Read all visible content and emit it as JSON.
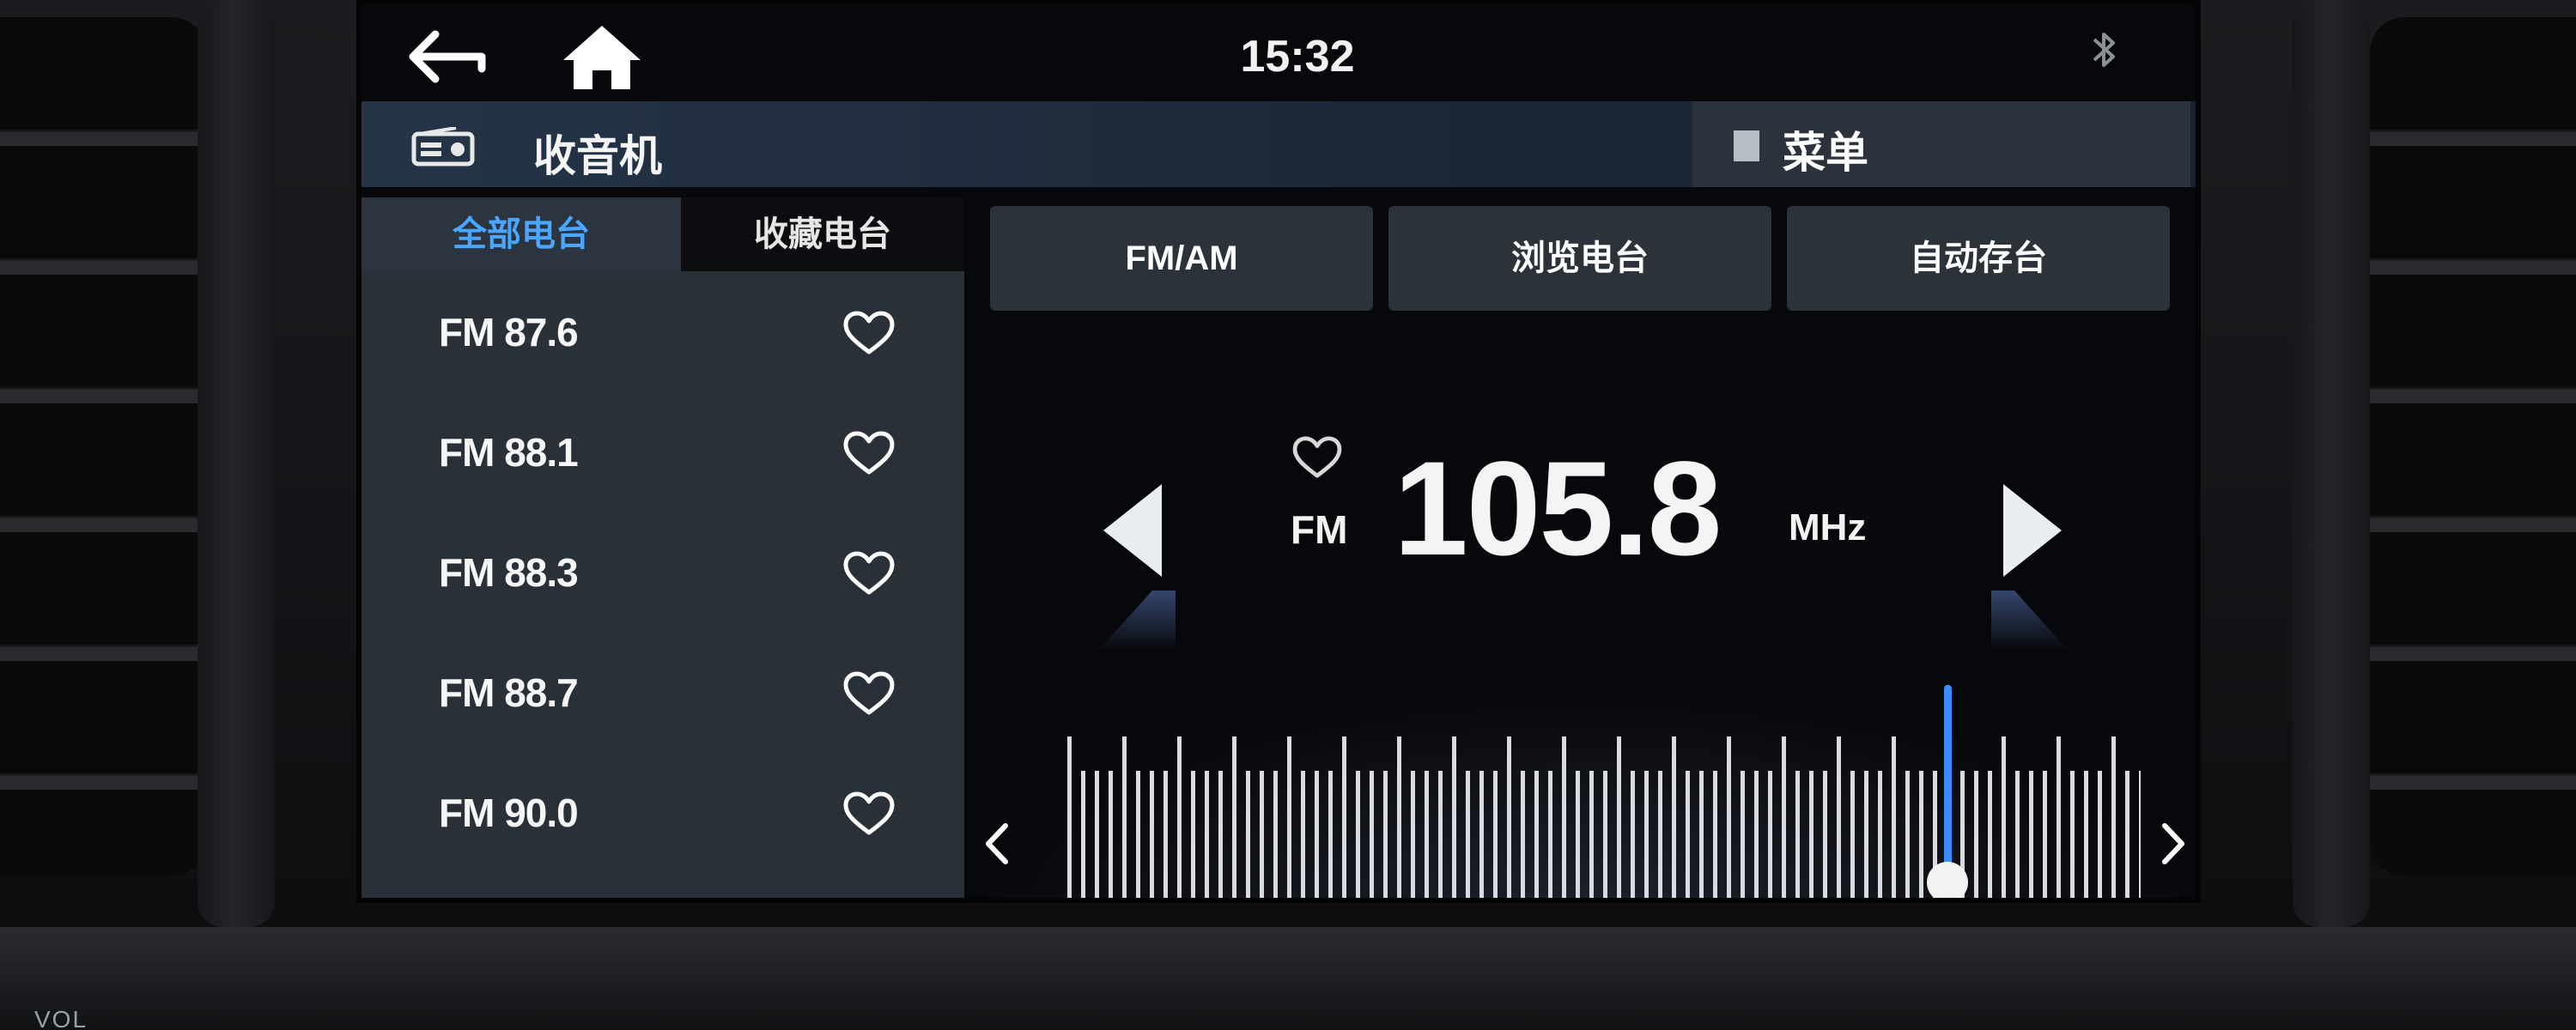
{
  "status": {
    "time": "15:32"
  },
  "title": {
    "text": "收音机"
  },
  "menu": {
    "label": "菜单"
  },
  "tabs": [
    {
      "label": "全部电台",
      "active": true
    },
    {
      "label": "收藏电台",
      "active": false
    }
  ],
  "stations": [
    {
      "name": "FM 87.6"
    },
    {
      "name": "FM 88.1"
    },
    {
      "name": "FM 88.3"
    },
    {
      "name": "FM 88.7"
    },
    {
      "name": "FM 90.0"
    }
  ],
  "buttons": {
    "fm_am": "FM/AM",
    "browse": "浏览电台",
    "autostore": "自动存台"
  },
  "tuner": {
    "band": "FM",
    "frequency": "105.8",
    "unit": "MHz"
  },
  "icons": {
    "back": "back-arrow-icon",
    "home": "home-icon",
    "bluetooth": "bluetooth-icon",
    "radio": "radio-icon",
    "favorite": "heart-outline-icon"
  },
  "colors": {
    "active_tab_text": "#4aa6ff",
    "tuner_needle": "#3a8dff",
    "panel_bg": "#2a3038",
    "button_bg": "#2c323a"
  }
}
